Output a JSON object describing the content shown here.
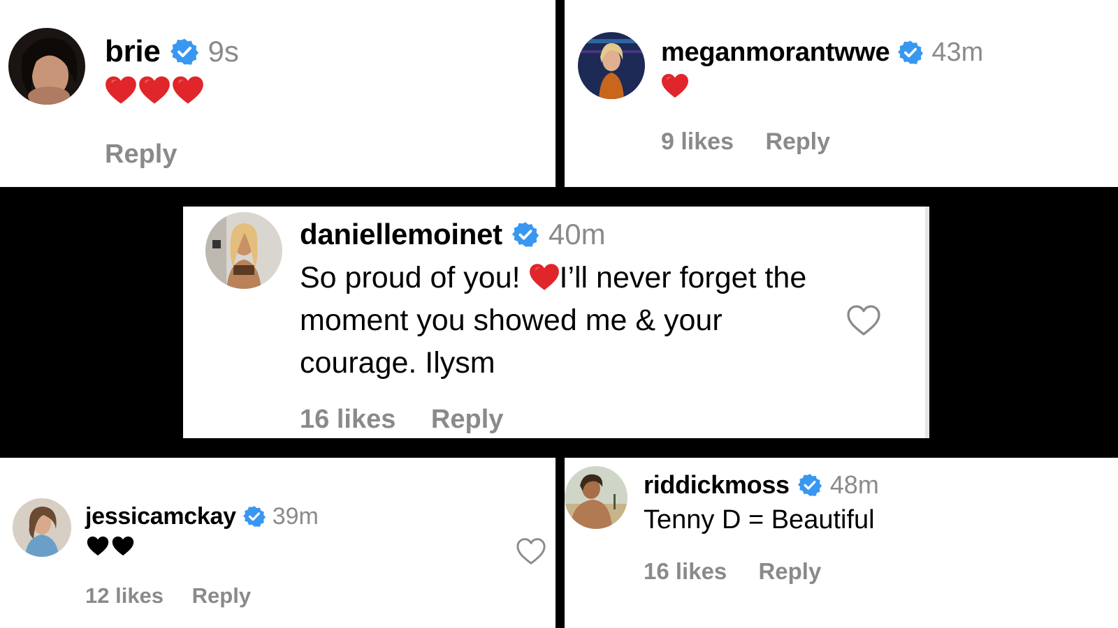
{
  "comments": [
    {
      "id": "brie",
      "username": "brie",
      "time": "9s",
      "text": "",
      "emoji": [
        "red-heart",
        "red-heart",
        "red-heart"
      ],
      "likes": "",
      "reply": "Reply"
    },
    {
      "id": "meganmorantwwe",
      "username": "meganmorantwwe",
      "time": "43m",
      "text": "",
      "emoji": [
        "red-heart"
      ],
      "likes": "9 likes",
      "reply": "Reply"
    },
    {
      "id": "daniellemoinet",
      "username": "daniellemoinet",
      "time": "40m",
      "text_before_emoji": "So proud of you! ",
      "emoji": [
        "red-heart"
      ],
      "text_after_emoji": "I’ll never forget the moment you showed me & your courage. Ilysm",
      "likes": "16 likes",
      "reply": "Reply"
    },
    {
      "id": "jessicamckay",
      "username": "jessicamckay",
      "time": "39m",
      "text": "",
      "emoji": [
        "black-heart",
        "black-heart"
      ],
      "likes": "12 likes",
      "reply": "Reply"
    },
    {
      "id": "riddickmoss",
      "username": "riddickmoss",
      "time": "48m",
      "text": "Tenny D = Beautiful",
      "likes": "16 likes",
      "reply": "Reply"
    }
  ],
  "icons": {
    "verified": "verified-badge-icon",
    "like": "heart-outline-icon"
  },
  "colors": {
    "verified_blue": "#3897f0",
    "red_heart": "#e0262b",
    "muted_text": "#8a8a8a",
    "separator": "#000000"
  }
}
